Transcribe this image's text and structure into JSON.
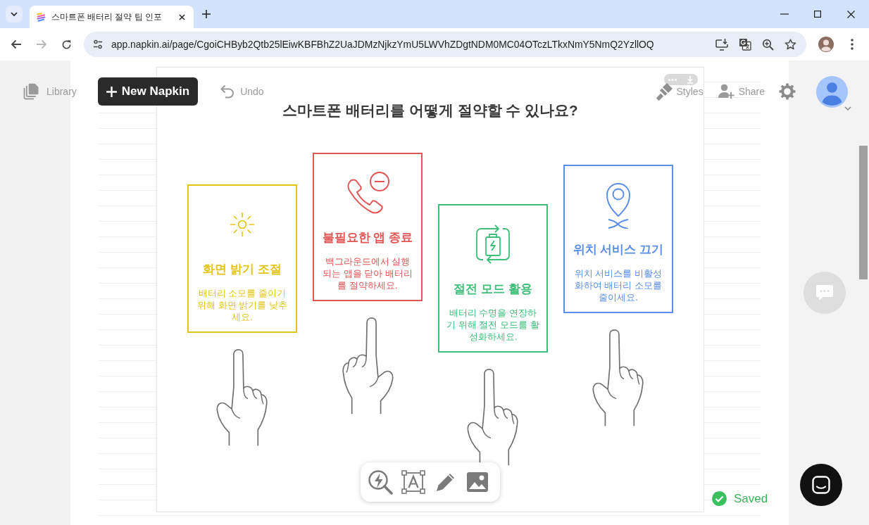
{
  "browser": {
    "tabs": [
      {
        "title": "스마트폰 배터리 절약 팁 인포",
        "selected": true
      }
    ],
    "forward_disabled": true,
    "url": "app.napkin.ai/page/CgoiCHByb2Qtb25lEiwKBFBhZ2UaJDMzNjkzYmU5LWVhZDgtNDM0MC04OTczLTkxNmY5NmQ2YzllOQ"
  },
  "toolbar": {
    "library": "Library",
    "new_napkin": "New Napkin",
    "undo": "Undo",
    "styles": "Styles",
    "share": "Share"
  },
  "infographic": {
    "title": "스마트폰 배터리를 어떻게 절약할 수 있나요?",
    "cards": [
      {
        "title": "화면 밝기 조절",
        "text": "배터리 소모를 줄이기 위해 화면 밝기를 낮추세요.",
        "color": "#e3c416"
      },
      {
        "title": "불필요한 앱 종료",
        "text": "백그라운드에서 실행되는 앱을 닫아 배터리를 절약하세요.",
        "color": "#e25555"
      },
      {
        "title": "절전 모드 활용",
        "text": "배터리 수명을 연장하기 위해 절전 모드를 활성화하세요.",
        "color": "#3dbf7a"
      },
      {
        "title": "위치 서비스 끄기",
        "text": "위치 서비스를 비활성화하여 배터리 소모를 줄이세요.",
        "color": "#5a8de8"
      }
    ]
  },
  "status": {
    "saved": "Saved"
  }
}
